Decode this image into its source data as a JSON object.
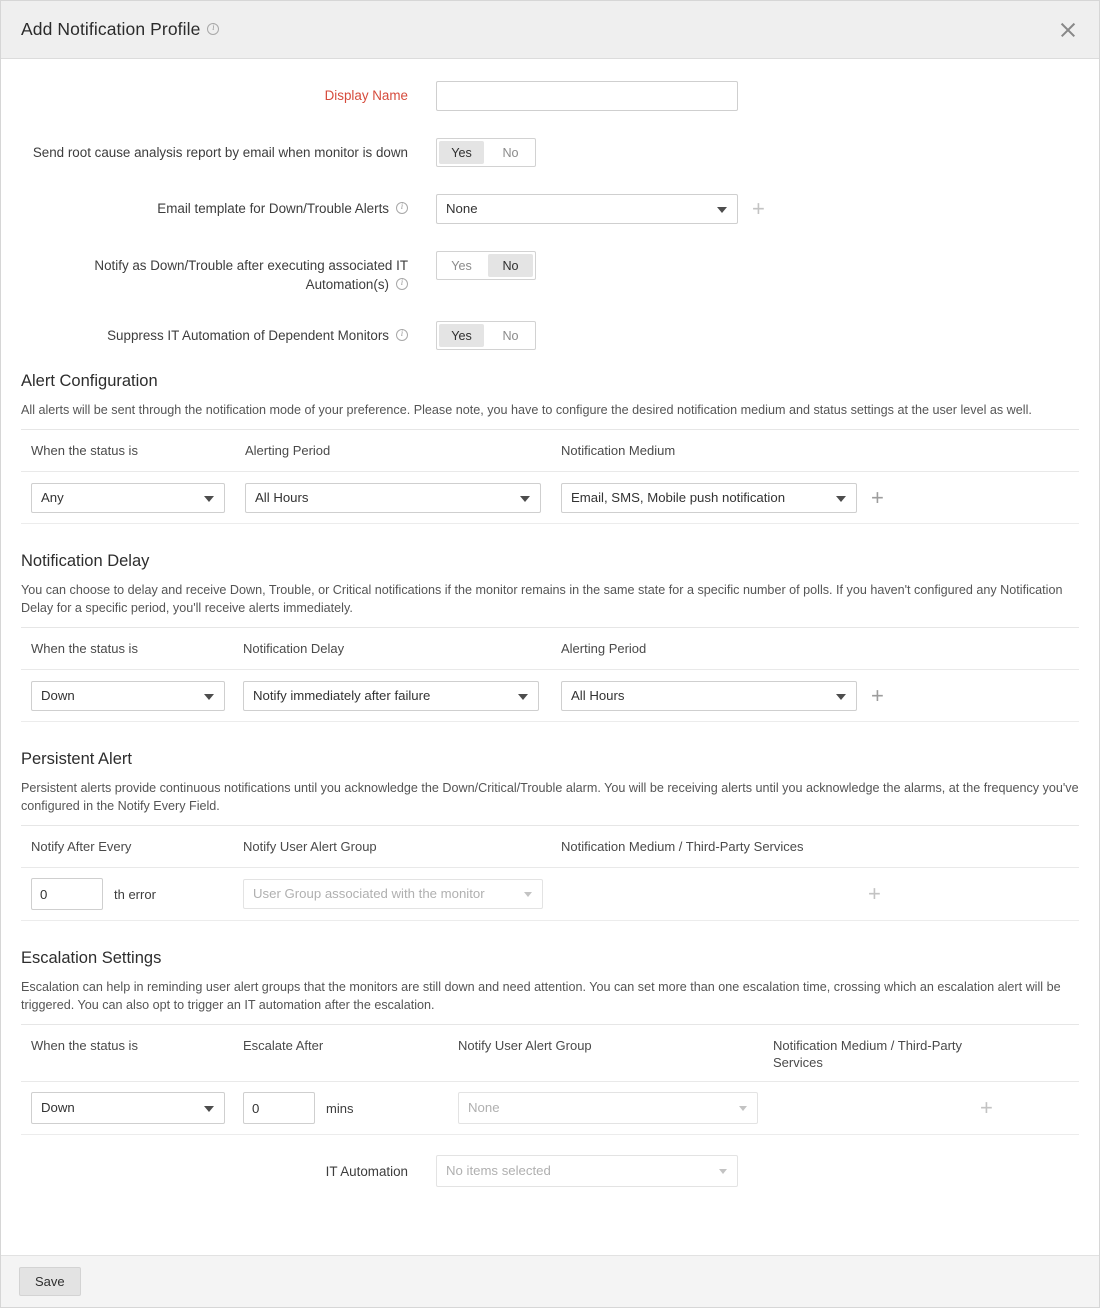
{
  "header": {
    "title": "Add Notification Profile",
    "info_icon": "info-icon",
    "close_icon": "close-icon"
  },
  "form": {
    "display_name": {
      "label": "Display Name",
      "value": "",
      "placeholder": ""
    },
    "rca_email": {
      "label": "Send root cause analysis report by email when monitor is down",
      "yes": "Yes",
      "no": "No",
      "selected": "Yes"
    },
    "email_template": {
      "label": "Email template for Down/Trouble Alerts",
      "value": "None",
      "add": "+"
    },
    "notify_after_automation": {
      "label": "Notify as Down/Trouble after executing associated IT Automation(s)",
      "yes": "Yes",
      "no": "No",
      "selected": "No"
    },
    "suppress_automation": {
      "label": "Suppress IT Automation of Dependent Monitors",
      "yes": "Yes",
      "no": "No",
      "selected": "Yes"
    }
  },
  "alert_configuration": {
    "title": "Alert Configuration",
    "description": "All alerts will be sent through the notification mode of your preference. Please note, you have to configure the desired notification medium and status settings at the user level as well.",
    "columns": [
      "When the status is",
      "Alerting Period",
      "Notification Medium"
    ],
    "row": {
      "status": "Any",
      "alerting_period": "All Hours",
      "notification_medium": "Email, SMS, Mobile push notification",
      "add": "+"
    }
  },
  "notification_delay": {
    "title": "Notification Delay",
    "description": "You can choose to delay and receive Down, Trouble, or Critical notifications if the monitor remains in the same state for a specific number of polls. If you haven't configured any Notification Delay for a specific period, you'll receive alerts immediately.",
    "columns": [
      "When the status is",
      "Notification Delay",
      "Alerting Period"
    ],
    "row": {
      "status": "Down",
      "delay": "Notify immediately after failure",
      "alerting_period": "All Hours",
      "add": "+"
    }
  },
  "persistent_alert": {
    "title": "Persistent Alert",
    "description": "Persistent alerts provide continuous notifications until you acknowledge the Down/Critical/Trouble alarm. You will be receiving alerts until you acknowledge the alarms, at the frequency you've configured in the Notify Every Field.",
    "columns": [
      "Notify After Every",
      "Notify User Alert Group",
      "Notification Medium / Third-Party Services"
    ],
    "row": {
      "notify_after": "0",
      "unit": "th error",
      "user_group_placeholder": "User Group associated with the monitor",
      "add": "+"
    }
  },
  "escalation_settings": {
    "title": "Escalation Settings",
    "description": "Escalation can help in reminding user alert groups that the monitors are still down and need attention. You can set more than one escalation time, crossing which an escalation alert will be triggered. You can also opt to trigger an IT automation after the escalation.",
    "columns": [
      "When the status is",
      "Escalate After",
      "Notify User Alert Group",
      "Notification Medium / Third-Party Services"
    ],
    "row": {
      "status": "Down",
      "escalate_after": "0",
      "unit": "mins",
      "user_group_placeholder": "None",
      "add": "+"
    },
    "it_automation": {
      "label": "IT Automation",
      "placeholder": "No items selected"
    }
  },
  "footer": {
    "save_label": "Save"
  },
  "colors": {
    "required_label": "#d64b3c",
    "header_bg": "#efefef",
    "footer_bg": "#f4f4f4",
    "border": "#cfcfcf",
    "toggle_on_bg": "#e4e4e4"
  }
}
